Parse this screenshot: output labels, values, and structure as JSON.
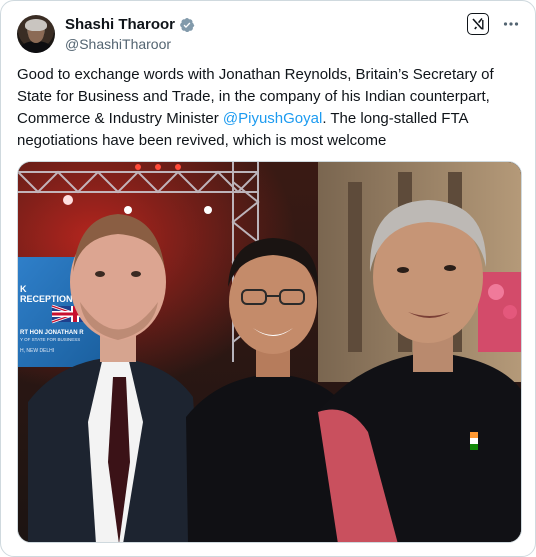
{
  "author": {
    "display_name": "Shashi Tharoor",
    "handle": "@ShashiTharoor",
    "verified_icon": "verified-badge-icon",
    "avatar": "profile-avatar"
  },
  "actions": {
    "grok_icon": "grok-icon",
    "more_icon": "more-options-icon"
  },
  "tweet": {
    "text_before": "Good to exchange words with Jonathan Reynolds, Britain’s Secretary of State for Business and Trade, in the company of his Indian counterpart, Commerce & Industry Minister ",
    "mention": "@PiyushGoyal",
    "text_after": ". The long-stalled FTA negotiations have been revived, which is most welcome"
  },
  "media": {
    "banner_line1": "K",
    "banner_line2": "RECEPTION",
    "banner_line3": "RT HON JONATHAN R",
    "banner_line4": "Y OF STATE FOR BUSINESS",
    "banner_line5": "H, NEW DELHI"
  },
  "colors": {
    "link": "#1d9bf0",
    "secondary_text": "#536471",
    "border": "#cfd9de",
    "verified": "#829aab"
  }
}
